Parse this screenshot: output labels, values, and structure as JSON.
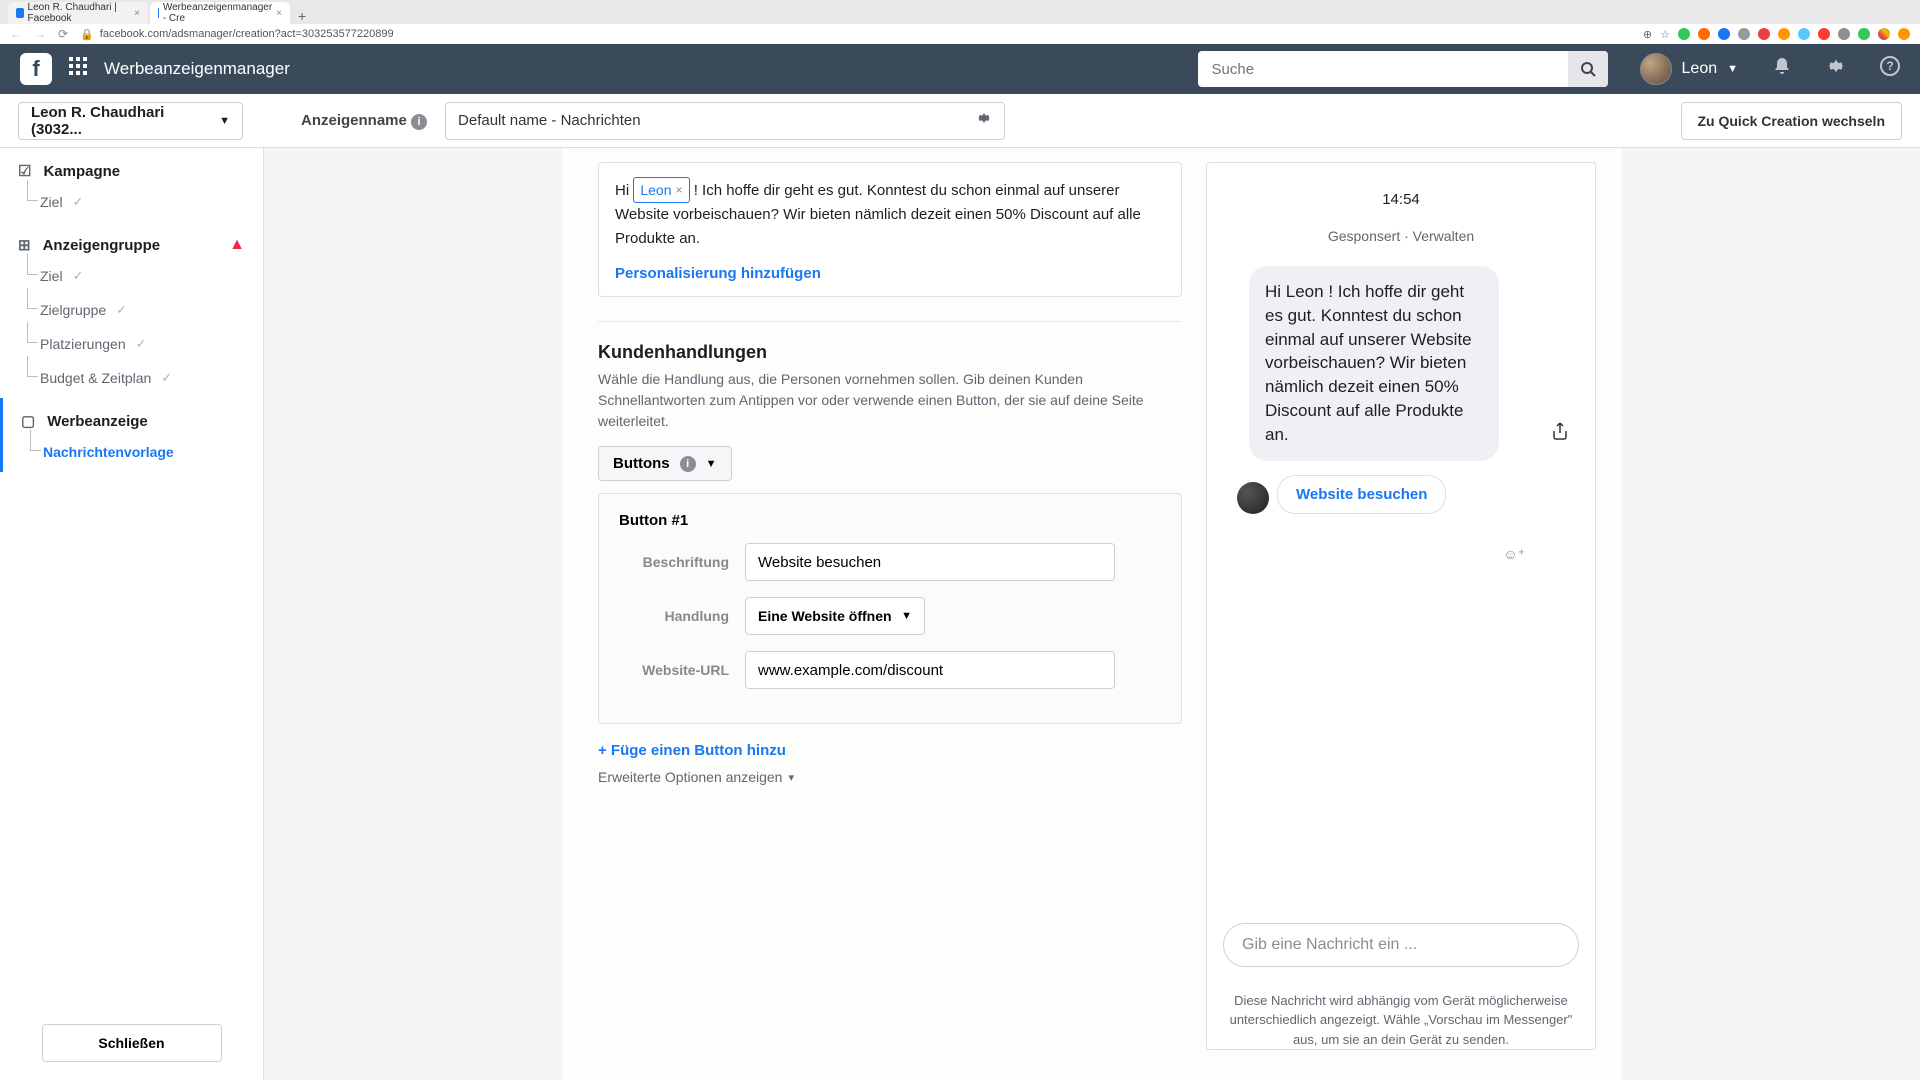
{
  "browser": {
    "tabs": [
      {
        "title": "Leon R. Chaudhari | Facebook"
      },
      {
        "title": "Werbeanzeigenmanager - Cre"
      }
    ],
    "url": "facebook.com/adsmanager/creation?act=303253577220899"
  },
  "topbar": {
    "app_title": "Werbeanzeigenmanager",
    "search_placeholder": "Suche",
    "user_name": "Leon"
  },
  "subheader": {
    "account": "Leon R. Chaudhari (3032...",
    "ad_name_label": "Anzeigenname",
    "ad_name_value": "Default name - Nachrichten",
    "quick_creation": "Zu Quick Creation wechseln"
  },
  "sidebar": {
    "campaign": "Kampagne",
    "campaign_items": [
      {
        "label": "Ziel"
      }
    ],
    "adset": "Anzeigengruppe",
    "adset_items": [
      {
        "label": "Ziel"
      },
      {
        "label": "Zielgruppe"
      },
      {
        "label": "Platzierungen"
      },
      {
        "label": "Budget & Zeitplan"
      }
    ],
    "ad": "Werbeanzeige",
    "ad_items": [
      {
        "label": "Nachrichtenvorlage"
      }
    ],
    "close_btn": "Schließen"
  },
  "form": {
    "greeting_prefix": "Hi",
    "token": "Leon",
    "greeting_suffix": "! Ich hoffe dir geht es gut. Konntest du schon einmal auf unserer Website vorbeischauen? Wir bieten nämlich dezeit einen 50% Discount auf alle Produkte an.",
    "personalize": "Personalisierung hinzufügen",
    "actions_title": "Kundenhandlungen",
    "actions_desc": "Wähle die Handlung aus, die Personen vornehmen sollen. Gib deinen Kunden Schnellantworten zum Antippen vor oder verwende einen Button, der sie auf deine Seite weiterleitet.",
    "buttons_label": "Buttons",
    "button_num": "Button #1",
    "label_caption": "Beschriftung",
    "caption_value": "Website besuchen",
    "label_action": "Handlung",
    "action_value": "Eine Website öffnen",
    "label_url": "Website-URL",
    "url_value": "www.example.com/discount",
    "add_button": "+ Füge einen Button hinzu",
    "adv_options": "Erweiterte Optionen anzeigen"
  },
  "preview": {
    "time": "14:54",
    "sponsor": "Gesponsert · Verwalten",
    "bubble": "Hi Leon ! Ich hoffe dir geht es gut. Konntest du schon einmal auf unserer Website vorbeischauen? Wir bieten nämlich dezeit einen 50% Discount auf alle Produkte an.",
    "cta": "Website besuchen",
    "input_placeholder": "Gib eine Nachricht ein ...",
    "footer": "Diese Nachricht wird abhängig vom Gerät möglicherweise unterschiedlich angezeigt. Wähle „Vorschau im Messenger\" aus, um sie an dein Gerät zu senden."
  }
}
